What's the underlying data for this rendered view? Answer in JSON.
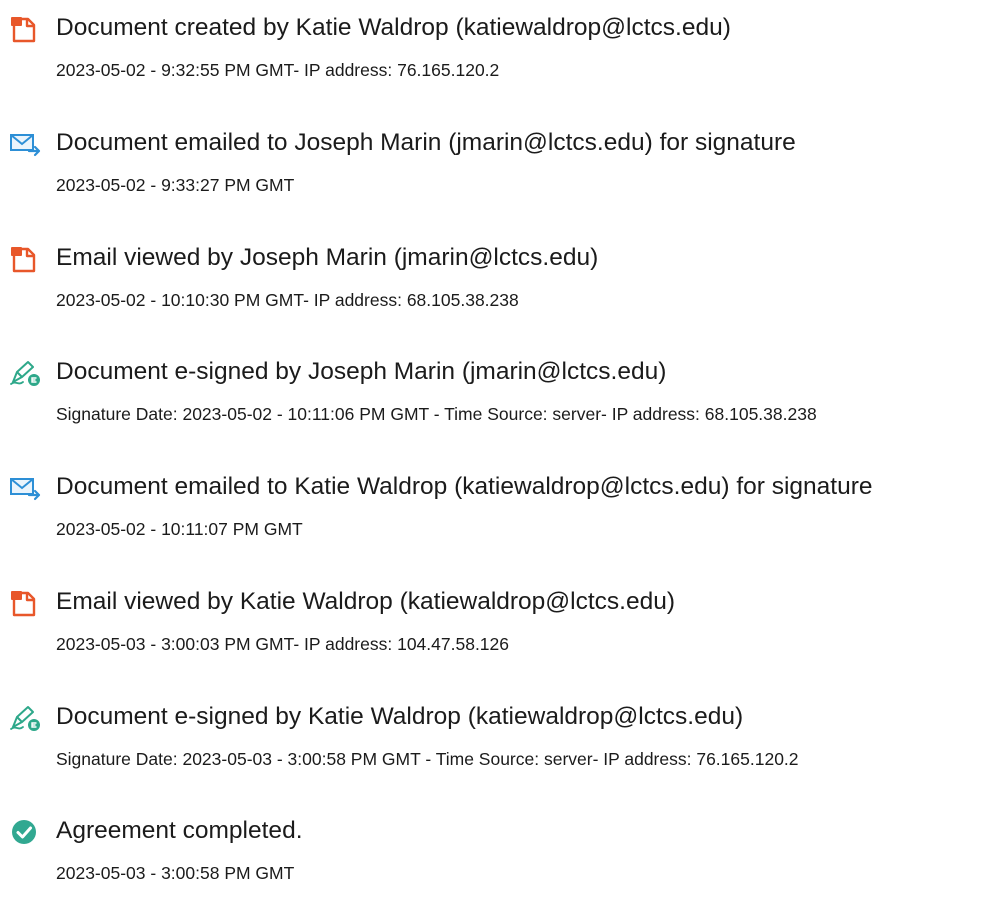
{
  "colors": {
    "doc_icon": "#e8572a",
    "email_icon": "#2d8fd6",
    "sign_icon": "#2ea88a",
    "complete_icon": "#31a891",
    "text": "#1b1b1b"
  },
  "entries": [
    {
      "icon": "document-icon",
      "title": "Document created by Katie Waldrop (katiewaldrop@lctcs.edu)",
      "detail": "2023-05-02 - 9:32:55 PM GMT- IP address: 76.165.120.2"
    },
    {
      "icon": "email-icon",
      "title": "Document emailed to Joseph Marin (jmarin@lctcs.edu) for signature",
      "detail": "2023-05-02 - 9:33:27 PM GMT"
    },
    {
      "icon": "document-icon",
      "title": "Email viewed by Joseph Marin (jmarin@lctcs.edu)",
      "detail": "2023-05-02 - 10:10:30 PM GMT- IP address: 68.105.38.238"
    },
    {
      "icon": "esign-pen-icon",
      "title": "Document e-signed by Joseph Marin (jmarin@lctcs.edu)",
      "detail": "Signature Date: 2023-05-02 - 10:11:06 PM GMT - Time Source: server- IP address: 68.105.38.238"
    },
    {
      "icon": "email-icon",
      "title": "Document emailed to Katie Waldrop (katiewaldrop@lctcs.edu) for signature",
      "detail": "2023-05-02 - 10:11:07 PM GMT"
    },
    {
      "icon": "document-icon",
      "title": "Email viewed by Katie Waldrop (katiewaldrop@lctcs.edu)",
      "detail": "2023-05-03 - 3:00:03 PM GMT- IP address: 104.47.58.126"
    },
    {
      "icon": "esign-pen-icon",
      "title": "Document e-signed by Katie Waldrop (katiewaldrop@lctcs.edu)",
      "detail": "Signature Date: 2023-05-03 - 3:00:58 PM GMT - Time Source: server- IP address: 76.165.120.2"
    },
    {
      "icon": "checkmark-circle-icon",
      "title": "Agreement completed.",
      "detail": "2023-05-03 - 3:00:58 PM GMT"
    }
  ]
}
